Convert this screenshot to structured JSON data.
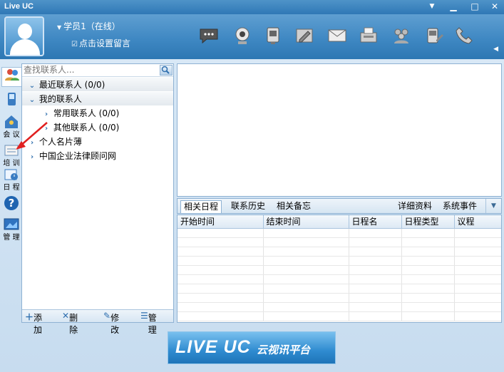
{
  "window": {
    "title": "Live UC"
  },
  "user": {
    "name": "学员1（在线）",
    "message": "点击设置留言"
  },
  "toolbar": {
    "icons": [
      "chat-bubble-icon",
      "webcam-icon",
      "remote-desktop-icon",
      "note-edit-icon",
      "mail-icon",
      "fax-icon",
      "group-icon",
      "sms-phone-icon",
      "phone-icon"
    ]
  },
  "sidebar": {
    "items": [
      {
        "icon": "contacts-icon",
        "label": ""
      },
      {
        "icon": "mobile-icon",
        "label": ""
      },
      {
        "icon": "meeting-icon",
        "label": "会 议"
      },
      {
        "icon": "training-icon",
        "label": "培 训"
      },
      {
        "icon": "schedule-icon",
        "label": "日 程"
      },
      {
        "icon": "help-icon",
        "label": ""
      },
      {
        "icon": "manage-icon",
        "label": "管 理"
      }
    ]
  },
  "contacts": {
    "search_placeholder": "查找联系人...",
    "tree": [
      {
        "label": "最近联系人 (0/0)",
        "level": 0,
        "expanded": true
      },
      {
        "label": "我的联系人",
        "level": 0,
        "expanded": true
      },
      {
        "label": "常用联系人 (0/0)",
        "level": 1,
        "expanded": false
      },
      {
        "label": "其他联系人 (0/0)",
        "level": 1,
        "expanded": false
      },
      {
        "label": "个人名片薄",
        "level": 0,
        "expanded": false
      },
      {
        "label": "中国企业法律顾问网",
        "level": 0,
        "expanded": false
      }
    ],
    "footer": {
      "add": "添加",
      "delete": "删除",
      "edit": "修改",
      "manage": "管理"
    }
  },
  "tabs": {
    "left": [
      "相关日程",
      "联系历史",
      "相关备忘"
    ],
    "right": [
      "详细资料",
      "系统事件"
    ]
  },
  "grid": {
    "columns": [
      "开始时间",
      "结束时间",
      "日程名",
      "日程类型",
      "议程"
    ]
  },
  "banner": {
    "brand": "LIVE UC",
    "tagline": "云视讯平台"
  },
  "colors": {
    "header": "#3f88c3",
    "titlebar": "#2f78b6",
    "annotation": "#e02020"
  }
}
